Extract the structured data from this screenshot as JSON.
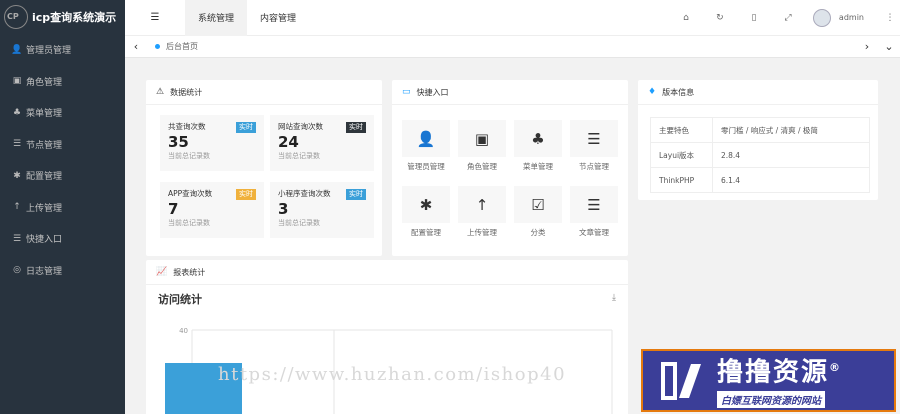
{
  "app": {
    "title": "icp查询系统演示"
  },
  "sidebar": {
    "items": [
      {
        "icon": "user-icon",
        "glyph": "👤",
        "label": "管理员管理"
      },
      {
        "icon": "role-icon",
        "glyph": "▣",
        "label": "角色管理"
      },
      {
        "icon": "tree-icon",
        "glyph": "♣",
        "label": "菜单管理"
      },
      {
        "icon": "list-icon",
        "glyph": "☰",
        "label": "节点管理"
      },
      {
        "icon": "asterisk-icon",
        "glyph": "✱",
        "label": "配置管理"
      },
      {
        "icon": "arrow-up-icon",
        "glyph": "↑",
        "label": "上传管理"
      },
      {
        "icon": "list-icon",
        "glyph": "☰",
        "label": "快捷入口"
      },
      {
        "icon": "globe-icon",
        "glyph": "◎",
        "label": "日志管理"
      }
    ]
  },
  "header": {
    "tabs": [
      {
        "label": "系统管理"
      },
      {
        "label": "内容管理"
      }
    ],
    "user": "admin"
  },
  "tabsbar": {
    "current": "后台首页"
  },
  "stats": {
    "title": "数据统计",
    "items": [
      {
        "title": "共查询次数",
        "value": "35",
        "sub": "当前总记录数",
        "badge": "实时",
        "badge_color": "#3ba0d9"
      },
      {
        "title": "网站查询次数",
        "value": "24",
        "sub": "当前总记录数",
        "badge": "实时",
        "badge_color": "#2f363c"
      },
      {
        "title": "APP查询次数",
        "value": "7",
        "sub": "当前总记录数",
        "badge": "实时",
        "badge_color": "#f0b13c"
      },
      {
        "title": "小程序查询次数",
        "value": "3",
        "sub": "当前总记录数",
        "badge": "实时",
        "badge_color": "#3ba0d9"
      }
    ]
  },
  "quick": {
    "title": "快捷入口",
    "items": [
      {
        "label": "管理员管理",
        "icon": "user-icon",
        "glyph": "👤"
      },
      {
        "label": "角色管理",
        "icon": "role-icon",
        "glyph": "▣"
      },
      {
        "label": "菜单管理",
        "icon": "tree-icon",
        "glyph": "♣"
      },
      {
        "label": "节点管理",
        "icon": "list-icon",
        "glyph": "☰"
      },
      {
        "label": "配置管理",
        "icon": "asterisk-icon",
        "glyph": "✱"
      },
      {
        "label": "上传管理",
        "icon": "arrow-up-icon",
        "glyph": "↑"
      },
      {
        "label": "分类",
        "icon": "calendar-check-icon",
        "glyph": "☑"
      },
      {
        "label": "文章管理",
        "icon": "list-icon",
        "glyph": "☰"
      }
    ]
  },
  "version": {
    "title": "版本信息",
    "rows": [
      {
        "key": "主要特色",
        "value": "零门槛 / 响应式 / 清爽 / 极简"
      },
      {
        "key": "Layui版本",
        "value": "2.8.4"
      },
      {
        "key": "ThinkPHP",
        "value": "6.1.4"
      }
    ]
  },
  "report": {
    "title": "报表统计",
    "chart_title": "访问统计",
    "download_icon": "download-icon"
  },
  "chart_data": {
    "type": "bar",
    "title": "访问统计",
    "ytick_top": "40",
    "series": [
      {
        "values": [
          null
        ]
      }
    ]
  },
  "watermark": {
    "url": "https://www.huzhan.com/ishop40",
    "brand": "撸撸资源",
    "registered": "®",
    "slogan": "白嫖互联网资源的网站",
    "brand_bg": "#3b3e98",
    "brand_border": "#e57a0e"
  }
}
